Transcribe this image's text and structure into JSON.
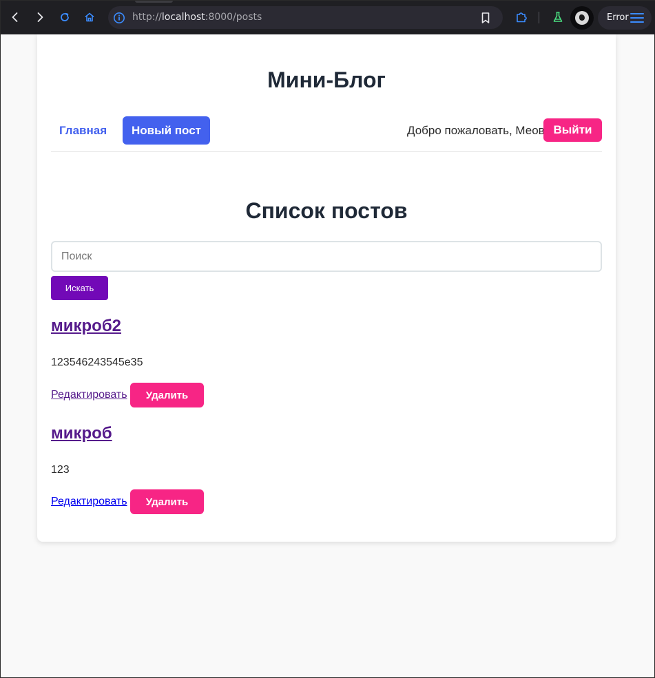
{
  "browser": {
    "url_scheme": "http://",
    "url_host": "localhost",
    "url_rest": ":8000/posts",
    "status_label": "Error",
    "icons": [
      "back-icon",
      "forward-icon",
      "reload-icon",
      "home-icon",
      "info-icon",
      "bookmark-icon",
      "extensions-icon",
      "lab-flask-icon",
      "avatar",
      "menu-icon"
    ]
  },
  "site": {
    "title": "Мини-Блог"
  },
  "nav": {
    "home_label": "Главная",
    "new_post_label": "Новый пост",
    "welcome_text": "Добро пожаловать, Меов",
    "logout_label": "Выйти"
  },
  "main": {
    "heading": "Список постов",
    "search_placeholder": "Поиск",
    "search_value": "",
    "search_button": "Искать"
  },
  "posts": [
    {
      "title": "микроб2",
      "body": "123546243545e35",
      "edit_label": "Редактировать",
      "delete_label": "Удалить"
    },
    {
      "title": "микроб",
      "body": "123",
      "edit_label": "Редактировать",
      "delete_label": "Удалить"
    }
  ],
  "colors": {
    "primary": "#4361ee",
    "danger": "#f72585",
    "search_button": "#7209b7",
    "visited_link": "#551a8b",
    "link": "#0000ee"
  }
}
